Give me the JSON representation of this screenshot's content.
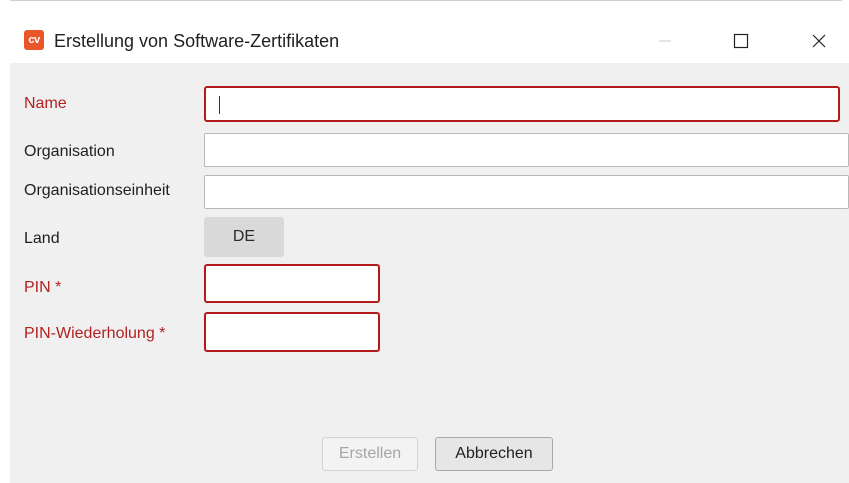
{
  "window": {
    "app_icon_text": "cv",
    "title": "Erstellung von Software-Zertifikaten",
    "controls": {
      "minimize_icon": "minimize-icon",
      "maximize_icon": "maximize-icon",
      "close_icon": "close-icon"
    }
  },
  "form": {
    "name": {
      "label": "Name",
      "value": ""
    },
    "organisation": {
      "label": "Organisation",
      "value": ""
    },
    "organisation_unit": {
      "label": "Organisationseinheit",
      "value": ""
    },
    "country": {
      "label": "Land",
      "value": "DE"
    },
    "pin": {
      "label": "PIN *",
      "value": ""
    },
    "pin_repeat": {
      "label": "PIN-Wiederholung *",
      "value": ""
    }
  },
  "buttons": {
    "create": "Erstellen",
    "cancel": "Abbrechen"
  },
  "colors": {
    "accent_brand": "#e8562a",
    "error_border": "#b31b1b",
    "required_label": "#b22222"
  }
}
